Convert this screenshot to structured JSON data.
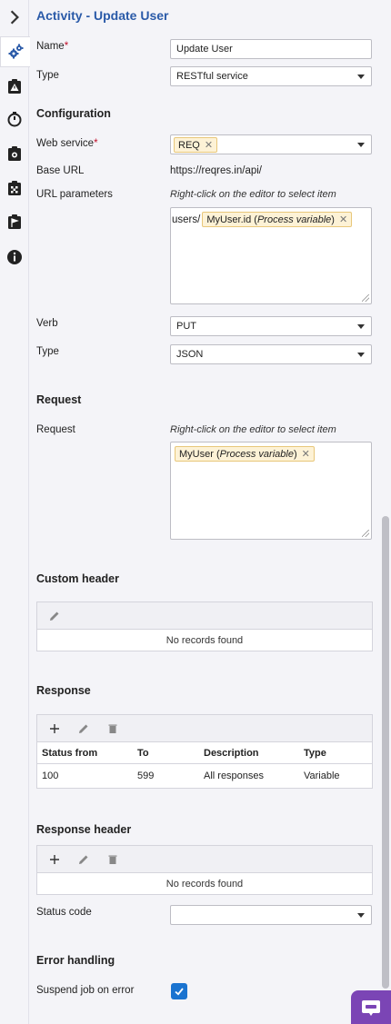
{
  "rail": {
    "expand_icon": "chevron-right-icon",
    "items": [
      {
        "icon": "gears-icon",
        "active": true
      },
      {
        "icon": "warning-clipboard-icon"
      },
      {
        "icon": "timer-icon"
      },
      {
        "icon": "camera-clipboard-icon"
      },
      {
        "icon": "checkered-flag-clipboard-icon"
      },
      {
        "icon": "flag-clipboard-icon"
      },
      {
        "icon": "info-icon"
      }
    ]
  },
  "title": "Activity - Update User",
  "fields": {
    "name_label": "Name",
    "name_value": "Update User",
    "type_label": "Type",
    "type_value": "RESTful service"
  },
  "configuration": {
    "heading": "Configuration",
    "web_service_label": "Web service",
    "web_service_chip": "REQ",
    "base_url_label": "Base URL",
    "base_url_value": "https://reqres.in/api/",
    "url_params_label": "URL parameters",
    "url_params_hint": "Right-click on the editor to select item",
    "url_params_prefix": "users/",
    "url_params_chip_name": "MyUser.id",
    "url_params_chip_kind": "Process variable",
    "verb_label": "Verb",
    "verb_value": "PUT",
    "type_label": "Type",
    "type_value": "JSON"
  },
  "request": {
    "heading": "Request",
    "label": "Request",
    "hint": "Right-click on the editor to select item",
    "chip_name": "MyUser",
    "chip_kind": "Process variable"
  },
  "custom_header": {
    "heading": "Custom header",
    "empty": "No records found"
  },
  "response": {
    "heading": "Response",
    "columns": [
      "Status from",
      "To",
      "Description",
      "Type"
    ],
    "rows": [
      [
        "100",
        "599",
        "All responses",
        "Variable"
      ]
    ]
  },
  "response_header": {
    "heading": "Response header",
    "empty": "No records found",
    "status_code_label": "Status code",
    "status_code_value": ""
  },
  "error_handling": {
    "heading": "Error handling",
    "suspend_label": "Suspend job on error",
    "suspend_checked": true
  },
  "colors": {
    "accent": "#2a5aa8",
    "checkbox": "#1a73d0",
    "chat": "#7b45b5"
  }
}
